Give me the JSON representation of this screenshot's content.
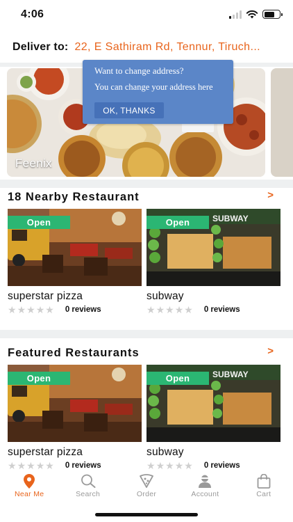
{
  "status_bar": {
    "time": "4:06"
  },
  "header": {
    "deliver_label": "Deliver to:",
    "address": "22, E Sathiram Rd, Tennur, Tiruch..."
  },
  "tooltip": {
    "title": "Want to change address?",
    "text": "You can change your address here",
    "button_label": "OK, THANKS"
  },
  "hero": {
    "caption": "Feenix"
  },
  "sections": [
    {
      "title": "18 Nearby Restaurant",
      "cards": [
        {
          "name": "superstar pizza",
          "badge": "Open",
          "reviews": "0 reviews"
        },
        {
          "name": "subway",
          "badge": "Open",
          "reviews": "0 reviews",
          "sign": "SUBWAY"
        }
      ]
    },
    {
      "title": "Featured Restaurants",
      "cards": [
        {
          "name": "superstar pizza",
          "badge": "Open",
          "reviews": "0 reviews"
        },
        {
          "name": "subway",
          "badge": "Open",
          "reviews": "0 reviews",
          "sign": "SUBWAY"
        }
      ]
    }
  ],
  "tab_bar": {
    "items": [
      {
        "label": "Near Me",
        "icon": "location-pin-icon",
        "active": true
      },
      {
        "label": "Search",
        "icon": "search-icon",
        "active": false
      },
      {
        "label": "Order",
        "icon": "pizza-slice-icon",
        "active": false
      },
      {
        "label": "Account",
        "icon": "user-icon",
        "active": false
      },
      {
        "label": "Cart",
        "icon": "shopping-bag-icon",
        "active": false
      }
    ]
  },
  "colors": {
    "accent": "#e8641c",
    "open_badge": "#2bb673",
    "tooltip_bg": "#5b86c8",
    "inactive_tab": "#9a9a9a"
  }
}
